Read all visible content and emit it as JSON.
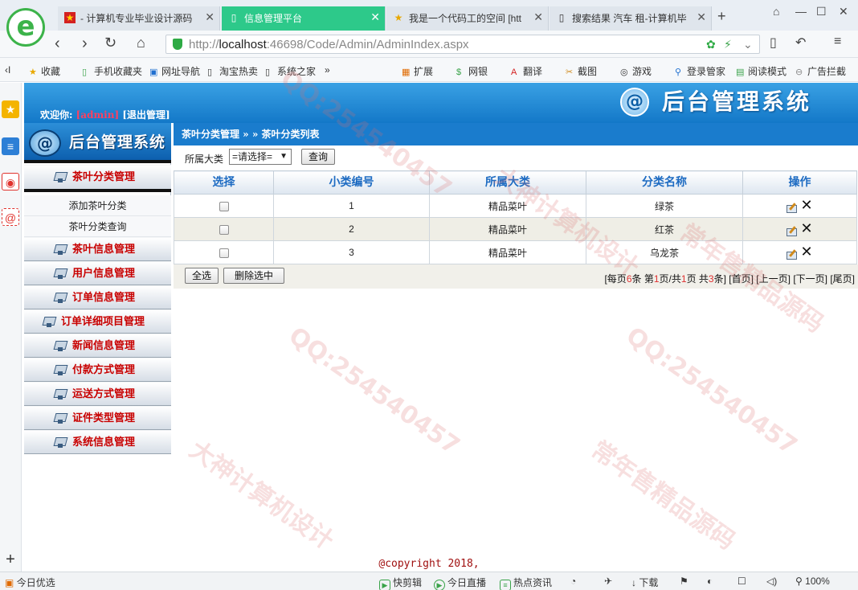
{
  "browser": {
    "tabs": [
      {
        "title": "- 计算机专业毕业设计源码",
        "icon": "flag-icon"
      },
      {
        "title": "信息管理平台",
        "icon": "page-icon"
      },
      {
        "title": "我是一个代码工的空间 [htt",
        "icon": "star-icon"
      },
      {
        "title": "搜索结果 汽车 租-计算机毕",
        "icon": "page-icon"
      }
    ],
    "active_tab": 1,
    "url_prefix": "http://",
    "url_host": "localhost",
    "url_rest": ":46698/Code/Admin/AdminIndex.aspx",
    "favorites_left": [
      "收藏",
      "手机收藏夹",
      "网址导航",
      "淘宝热卖",
      "系统之家"
    ],
    "favorites_right": [
      "扩展",
      "网银",
      "翻译",
      "截图",
      "游戏",
      "登录管家",
      "阅读模式",
      "广告拦截"
    ],
    "favorites_more": "»"
  },
  "header": {
    "welcome_prefix": "欢迎你:",
    "username": "[admin]",
    "logout_label": "[退出管理]",
    "brand_title": "后台管理系统",
    "brand_logo_glyph": "@"
  },
  "sidebar": {
    "banner_title": "后台管理系统",
    "sections": [
      {
        "label": "茶叶分类管理",
        "open": true,
        "items": [
          "添加茶叶分类",
          "茶叶分类查询"
        ]
      },
      {
        "label": "茶叶信息管理"
      },
      {
        "label": "用户信息管理"
      },
      {
        "label": "订单信息管理"
      },
      {
        "label": "订单详细项目管理"
      },
      {
        "label": "新闻信息管理"
      },
      {
        "label": "付款方式管理"
      },
      {
        "label": "运送方式管理"
      },
      {
        "label": "证件类型管理"
      },
      {
        "label": "系统信息管理"
      }
    ]
  },
  "main": {
    "breadcrumb": "茶叶分类管理 » » 茶叶分类列表",
    "filter": {
      "label": "所属大类",
      "select_value": "=请选择=",
      "search_label": "查询"
    },
    "table": {
      "columns": [
        "选择",
        "小类编号",
        "所属大类",
        "分类名称",
        "操作"
      ],
      "rows": [
        {
          "id": "1",
          "category": "精品菜叶",
          "name": "绿茶"
        },
        {
          "id": "2",
          "category": "精品菜叶",
          "name": "红茶"
        },
        {
          "id": "3",
          "category": "精品菜叶",
          "name": "乌龙茶"
        }
      ]
    },
    "select_all_label": "全选",
    "delete_selected_label": "删除选中",
    "pager": {
      "per_page_prefix": "[每页",
      "per_page": "6",
      "page_prefix": "条 第",
      "page": "1",
      "total_prefix": "页/共",
      "total_pages": "1",
      "count_prefix": "页 共",
      "total_count": "3",
      "count_suffix": "条]",
      "first": "[首页]",
      "prev": "[上一页]",
      "next": "[下一页]",
      "last": "[尾页]"
    }
  },
  "footer": {
    "copyright": "@copyright 2018,"
  },
  "statusbar": {
    "left": "今日优选",
    "items": [
      "快剪辑",
      "今日直播",
      "热点资讯",
      "下载"
    ],
    "zoom": "100%"
  },
  "watermarks": [
    "QQ:254540457",
    "大神计算机设计",
    "常年售精品源码"
  ]
}
